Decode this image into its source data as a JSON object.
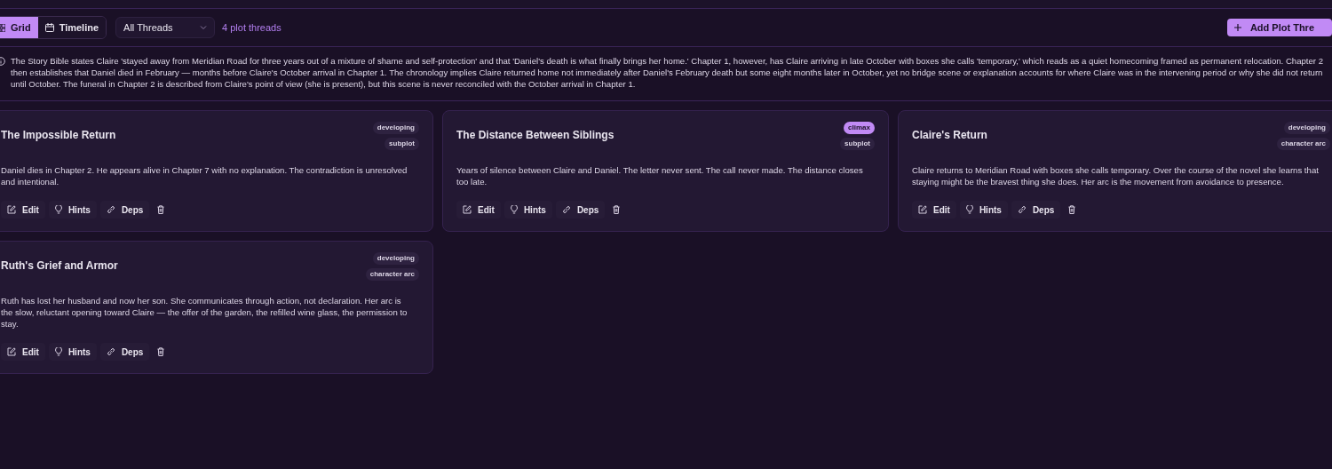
{
  "view_tabs": [
    {
      "label": "Grid",
      "selected": true
    },
    {
      "label": "Timeline",
      "selected": false
    }
  ],
  "filter": {
    "value": "All Threads"
  },
  "count": "4 plot threads",
  "add_button": "Add Plot Thre",
  "notice": "The Story Bible states Claire 'stayed away from Meridian Road for three years out of a mixture of shame and self-protection' and that 'Daniel's death is what finally brings her home.' Chapter 1, however, has Claire arriving in late October with boxes she calls 'temporary,' which reads as a quiet homecoming framed as permanent relocation. Chapter 2 then establishes that Daniel died in February — months before Claire's October arrival in Chapter 1. The chronology implies Claire returned home not immediately after Daniel's February death but some eight months later in October, yet no bridge scene or explanation accounts for where Claire was in the intervening period or why she did not return until October. The funeral in Chapter 2 is described from Claire's point of view (she is present), but this scene is never reconciled with the October arrival in Chapter 1.",
  "threads": [
    {
      "title": "The Impossible Return",
      "tags": [
        {
          "label": "developing",
          "highlighted": false
        },
        {
          "label": "subplot",
          "highlighted": false
        }
      ],
      "description": "Daniel dies in Chapter 2. He appears alive in Chapter 7 with no explanation. The contradiction is unresolved and intentional.",
      "actions": [
        "Edit",
        "Hints",
        "Deps"
      ]
    },
    {
      "title": "The Distance Between Siblings",
      "tags": [
        {
          "label": "climax",
          "highlighted": true
        },
        {
          "label": "subplot",
          "highlighted": false
        }
      ],
      "description": "Years of silence between Claire and Daniel. The letter never sent. The call never made. The distance closes too late.",
      "actions": [
        "Edit",
        "Hints",
        "Deps"
      ]
    },
    {
      "title": "Claire's Return",
      "tags": [
        {
          "label": "developing",
          "highlighted": false
        },
        {
          "label": "character arc",
          "highlighted": false
        }
      ],
      "description": "Claire returns to Meridian Road with boxes she calls temporary. Over the course of the novel she learns that staying might be the bravest thing she does. Her arc is the movement from avoidance to presence.",
      "actions": [
        "Edit",
        "Hints",
        "Deps"
      ]
    },
    {
      "title": "Ruth's Grief and Armor",
      "tags": [
        {
          "label": "developing",
          "highlighted": false
        },
        {
          "label": "character arc",
          "highlighted": false
        }
      ],
      "description": "Ruth has lost her husband and now her son. She communicates through action, not declaration. Her arc is the slow, reluctant opening toward Claire — the offer of the garden, the refilled wine glass, the permission to stay.",
      "actions": [
        "Edit",
        "Hints",
        "Deps"
      ]
    }
  ]
}
